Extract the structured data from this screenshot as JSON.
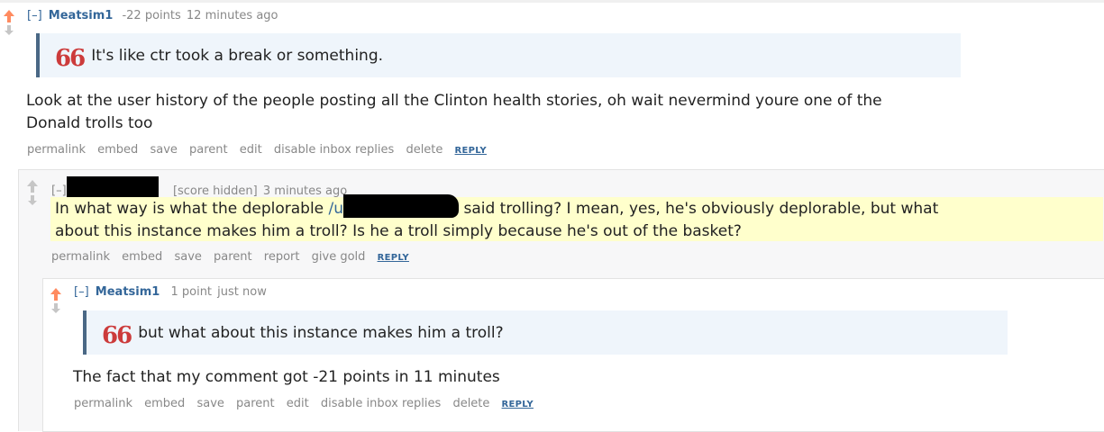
{
  "comment1": {
    "expand": "[–]",
    "author": "Meatsim1",
    "score": "-22 points",
    "time": "12 minutes ago",
    "quote": "It's like ctr took a break or something.",
    "body_line1": "Look at the user history of the people posting all the Clinton health stories, oh wait nevermind youre one of the",
    "body_line2": "Donald trolls too",
    "buttons": [
      "permalink",
      "embed",
      "save",
      "parent",
      "edit",
      "disable inbox replies",
      "delete"
    ],
    "reply": "REPLY"
  },
  "comment2": {
    "expand": "[–]",
    "score": "[score hidden]",
    "time": "3 minutes ago",
    "body_line1_a": "In what way is what the deplorable",
    "body_line1_link": "/u",
    "body_line1_b": "said trolling? I mean, yes, he's obviously deplorable, but what",
    "body_line2": "about this instance makes him a troll? Is he a troll simply because he's out of the basket?",
    "buttons": [
      "permalink",
      "embed",
      "save",
      "parent",
      "report",
      "give gold"
    ],
    "reply": "REPLY"
  },
  "comment3": {
    "expand": "[–]",
    "author": "Meatsim1",
    "score": "1 point",
    "time": "just now",
    "quote": "but what about this instance makes him a troll?",
    "body": "The fact that my comment got -21 points in 11 minutes",
    "buttons": [
      "permalink",
      "embed",
      "save",
      "parent",
      "edit",
      "disable inbox replies",
      "delete"
    ],
    "reply": "REPLY"
  },
  "colors": {
    "upvote": "#ff8b60",
    "author": "#336699",
    "quote_bg": "#eff5fb",
    "quote_border": "#4a6885",
    "quote_mark": "#cc3b3b",
    "highlight": "#ffffcc"
  },
  "icons": [
    "upvote-arrow-icon",
    "downvote-arrow-icon",
    "quote-mark-icon"
  ]
}
